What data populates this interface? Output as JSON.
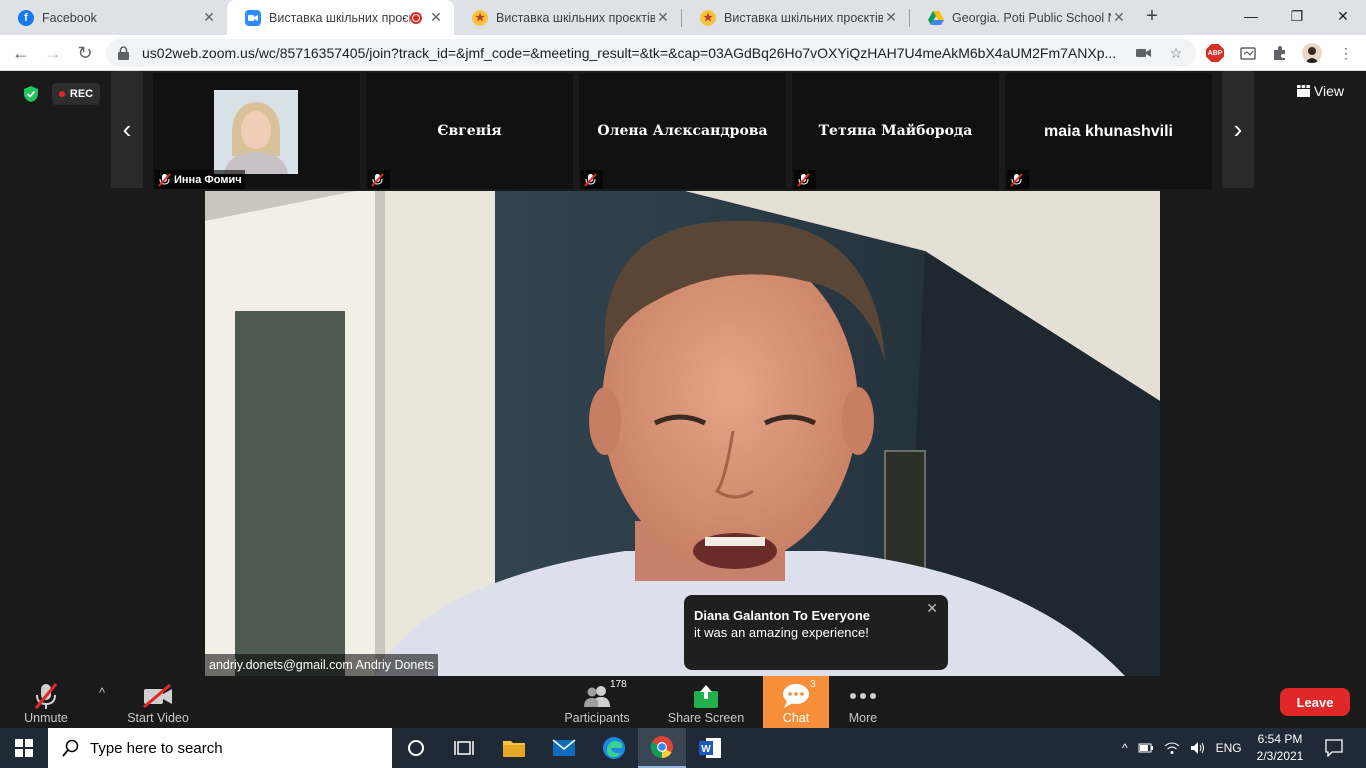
{
  "browser": {
    "tabs": [
      {
        "title": "Facebook",
        "icon": "facebook-icon",
        "active": false
      },
      {
        "title": "Виставка шкільних проєктів",
        "icon": "zoom-icon",
        "active": true,
        "recording": true
      },
      {
        "title": "Виставка шкільних проєктів з",
        "icon": "star-eyes-emoji-icon",
        "active": false
      },
      {
        "title": "Виставка шкільних проєктів з",
        "icon": "star-eyes-emoji-icon",
        "active": false
      },
      {
        "title": "Georgia. Poti Public School N",
        "icon": "google-drive-icon",
        "active": false
      }
    ],
    "new_tab": "+",
    "url": "us02web.zoom.us/wc/85716357405/join?track_id=&jmf_code=&meeting_result=&tk=&cap=03AGdBq26Ho7vOXYiQzHAH7U4meAkM6bX4aUM2Fm7ANXp...",
    "extension_abp": "ABP"
  },
  "zoom": {
    "rec_label": "REC",
    "view_label": "View",
    "participants_strip": [
      {
        "name": "Инна Фомич",
        "has_video": true,
        "muted": true
      },
      {
        "name": "Євгенія",
        "has_video": false,
        "muted": true
      },
      {
        "name": "Олена Алєксандрова",
        "has_video": false,
        "muted": true
      },
      {
        "name": "Тетяна Майборода",
        "has_video": false,
        "muted": true
      },
      {
        "name": "maia khunashvili",
        "has_video": false,
        "muted": true
      }
    ],
    "active_speaker": "andriy.donets@gmail.com Andriy Donets",
    "chat_toast": {
      "from": "Diana Galanton To Everyone",
      "message": "it was an amazing experience!"
    },
    "controls": {
      "unmute": "Unmute",
      "start_video": "Start Video",
      "participants": "Participants",
      "participants_count": "178",
      "share_screen": "Share Screen",
      "chat": "Chat",
      "chat_count": "3",
      "more": "More",
      "leave": "Leave"
    }
  },
  "taskbar": {
    "search_placeholder": "Type here to search",
    "language": "ENG",
    "time": "6:54 PM",
    "date": "2/3/2021"
  },
  "colors": {
    "zoom_bg": "#1a1a1a",
    "chat_active": "#f68e3a",
    "leave_red": "#e02828",
    "share_green": "#21b04b"
  }
}
